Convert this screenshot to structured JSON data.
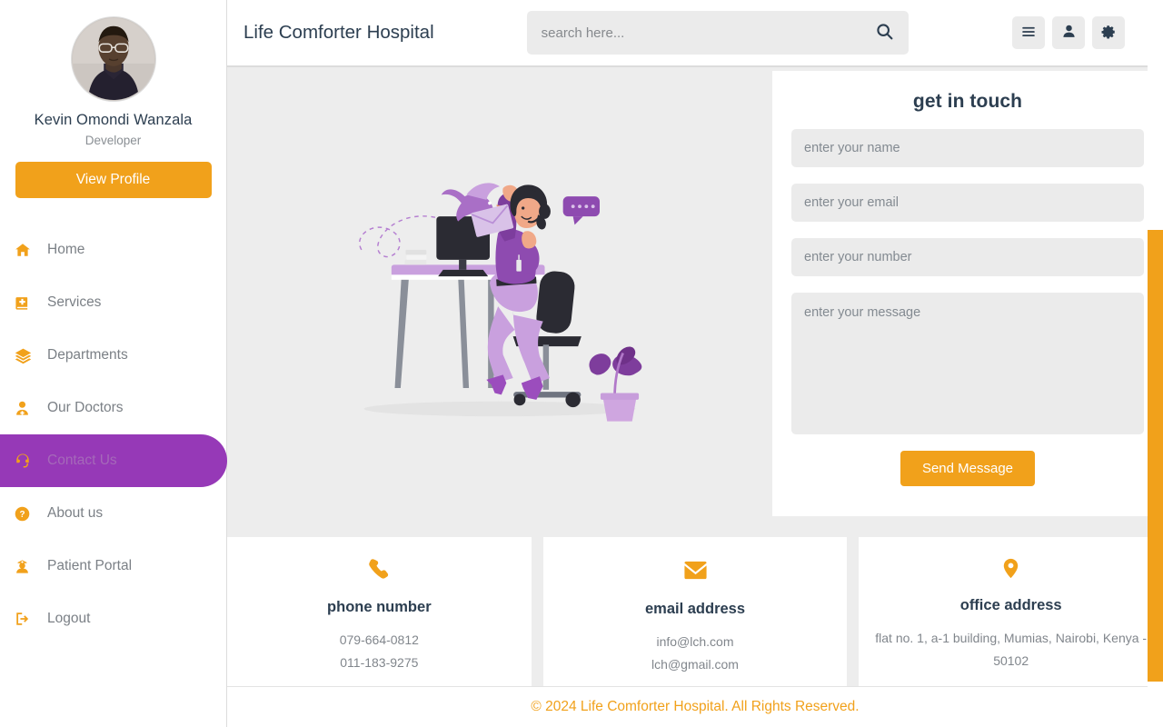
{
  "sidebar": {
    "profile": {
      "name": "Kevin Omondi Wanzala",
      "role": "Developer",
      "view_profile_label": "View Profile"
    },
    "items": [
      {
        "label": "Home",
        "icon": "home-icon",
        "active": false
      },
      {
        "label": "Services",
        "icon": "book-medical-icon",
        "active": false
      },
      {
        "label": "Departments",
        "icon": "layers-icon",
        "active": false
      },
      {
        "label": "Our Doctors",
        "icon": "user-doctor-icon",
        "active": false
      },
      {
        "label": "Contact Us",
        "icon": "headset-icon",
        "active": true
      },
      {
        "label": "About us",
        "icon": "question-circle-icon",
        "active": false
      },
      {
        "label": "Patient Portal",
        "icon": "user-nurse-icon",
        "active": false
      },
      {
        "label": "Logout",
        "icon": "logout-icon",
        "active": false
      }
    ]
  },
  "header": {
    "brand": "Life Comforter Hospital",
    "search_placeholder": "search here...",
    "search_value": "",
    "search_icon": "search-icon",
    "actions": [
      {
        "name": "menu-button",
        "icon": "hamburger-icon"
      },
      {
        "name": "user-button",
        "icon": "user-icon"
      },
      {
        "name": "settings-button",
        "icon": "gear-icon"
      }
    ]
  },
  "main": {
    "illustration": "customer-service-illustration",
    "form": {
      "title": "get in touch",
      "name_placeholder": "enter your name",
      "name_value": "",
      "email_placeholder": "enter your email",
      "email_value": "",
      "number_placeholder": "enter your number",
      "number_value": "",
      "message_placeholder": "enter your message",
      "message_value": "",
      "submit_label": "Send Message"
    },
    "info_cards": [
      {
        "icon": "phone-icon",
        "title": "phone number",
        "lines": [
          "079-664-0812",
          "011-183-9275"
        ]
      },
      {
        "icon": "envelope-icon",
        "title": "email address",
        "lines": [
          "info@lch.com",
          "lch@gmail.com"
        ]
      },
      {
        "icon": "map-pin-icon",
        "title": "office address",
        "lines": [
          "flat no. 1, a-1 building, Mumias, Nairobi, Kenya - 50102"
        ]
      }
    ]
  },
  "footer": {
    "text": "© 2024 Life Comforter Hospital. All Rights Reserved."
  },
  "colors": {
    "accent_orange": "#f1a11b",
    "accent_purple": "#9639b7",
    "text_dark": "#2c3e50",
    "text_muted": "#81868c",
    "bg_gray": "#ededed"
  }
}
